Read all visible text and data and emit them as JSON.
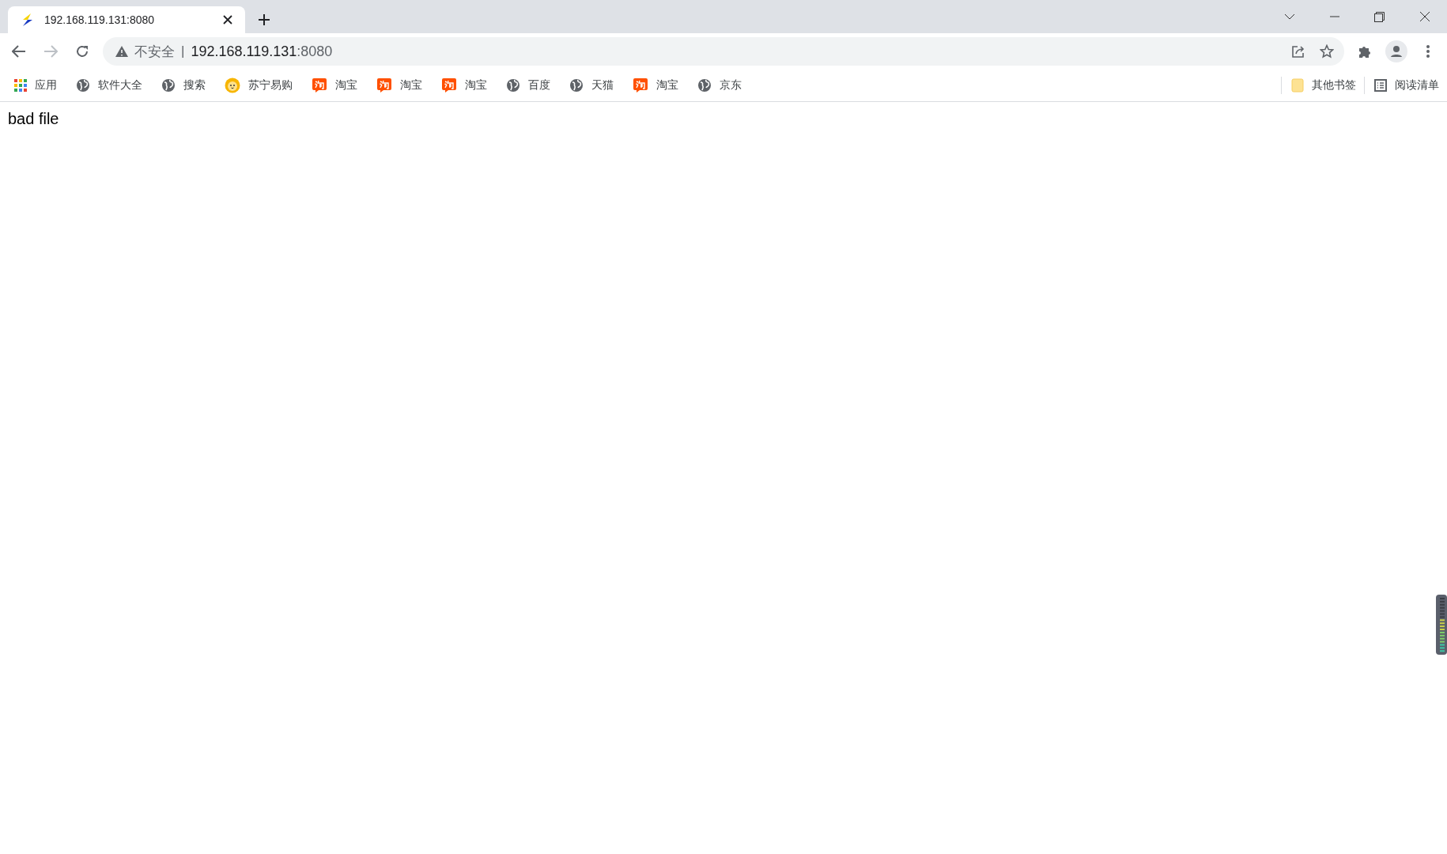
{
  "tab": {
    "title": "192.168.119.131:8080",
    "selected": true
  },
  "address_bar": {
    "security_label": "不安全",
    "separator": "|",
    "host": "192.168.119.131",
    "port": ":8080"
  },
  "bookmarks": [
    {
      "kind": "apps",
      "label": "应用"
    },
    {
      "kind": "globe",
      "label": "软件大全"
    },
    {
      "kind": "globe",
      "label": "搜索"
    },
    {
      "kind": "lion",
      "label": "苏宁易购"
    },
    {
      "kind": "taobao",
      "label": "淘宝"
    },
    {
      "kind": "taobao",
      "label": "淘宝"
    },
    {
      "kind": "taobao",
      "label": "淘宝"
    },
    {
      "kind": "globe",
      "label": "百度"
    },
    {
      "kind": "globe",
      "label": "天猫"
    },
    {
      "kind": "taobao",
      "label": "淘宝"
    },
    {
      "kind": "globe",
      "label": "京东"
    }
  ],
  "other_bookmarks": "其他书签",
  "reading_list": "阅读清单",
  "page": {
    "text": "bad file"
  }
}
